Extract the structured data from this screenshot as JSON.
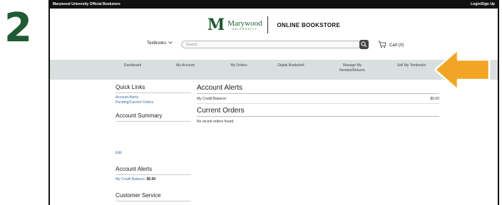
{
  "step": "2",
  "topbar": {
    "store_name": "Marywood University Official Bookstore",
    "login": "Login/Sign Up"
  },
  "logo": {
    "mark": "M",
    "name": "Marywood",
    "sub": "UNIVERSITY",
    "store": "ONLINE BOOKSTORE"
  },
  "header": {
    "textbooks_label": "Textbooks",
    "search_placeholder": "Search",
    "cart_label": "Cart (0)"
  },
  "nav": {
    "dashboard": "Dashboard",
    "my_account": "My Account",
    "my_orders": "My Orders",
    "digital_bookshelf": "Digital Bookshelf",
    "manage_rentals_1": "Manage My",
    "manage_rentals_2": "Rentals/Returns",
    "sell_textbooks": "Sell My Textbooks"
  },
  "sidebar": {
    "quick_links_title": "Quick Links",
    "account_alerts_link": "Account Alerts",
    "pending_orders_link": "Pending/Current Orders",
    "account_summary_title": "Account Summary",
    "edit_link": "Edit",
    "account_alerts_title": "Account Alerts",
    "credit_label": "My Credit Balance:",
    "credit_value": "$0.00",
    "customer_service_title": "Customer Service"
  },
  "main": {
    "alerts_title": "Account Alerts",
    "credit_label": "My Credit Balance:",
    "credit_value": "$0.00",
    "orders_title": "Current Orders",
    "no_orders": "No recent orders found."
  },
  "colors": {
    "brand_green": "#1f5a33",
    "arrow_orange": "#f2a524",
    "nav_bg": "#d9dfdf"
  }
}
